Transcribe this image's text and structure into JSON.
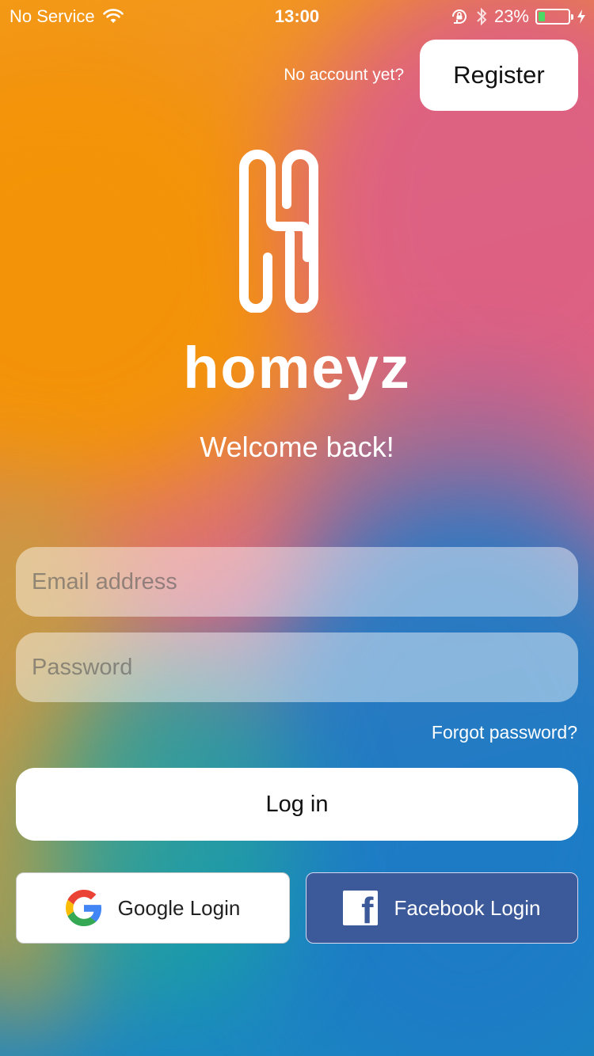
{
  "status_bar": {
    "carrier": "No Service",
    "time": "13:00",
    "battery_percent": "23%",
    "battery_level": 0.23,
    "icons": [
      "wifi-icon",
      "rotation-lock-icon",
      "bluetooth-icon",
      "battery-icon",
      "charging-icon"
    ]
  },
  "header": {
    "no_account_text": "No account yet?",
    "register_label": "Register"
  },
  "brand": {
    "logo_icon": "homeyz-h-logo",
    "name": "homeyz"
  },
  "welcome_text": "Welcome back!",
  "form": {
    "email_placeholder": "Email address",
    "email_value": "",
    "password_placeholder": "Password",
    "password_value": "",
    "forgot_password": "Forgot password?",
    "login_label": "Log in"
  },
  "social": {
    "google_label": "Google Login",
    "facebook_label": "Facebook Login"
  },
  "colors": {
    "facebook_blue": "#3c5a9a",
    "battery_green": "#4cd964",
    "google_blue": "#4285F4",
    "google_red": "#EA4335",
    "google_yellow": "#FBBC05",
    "google_green": "#34A853"
  }
}
